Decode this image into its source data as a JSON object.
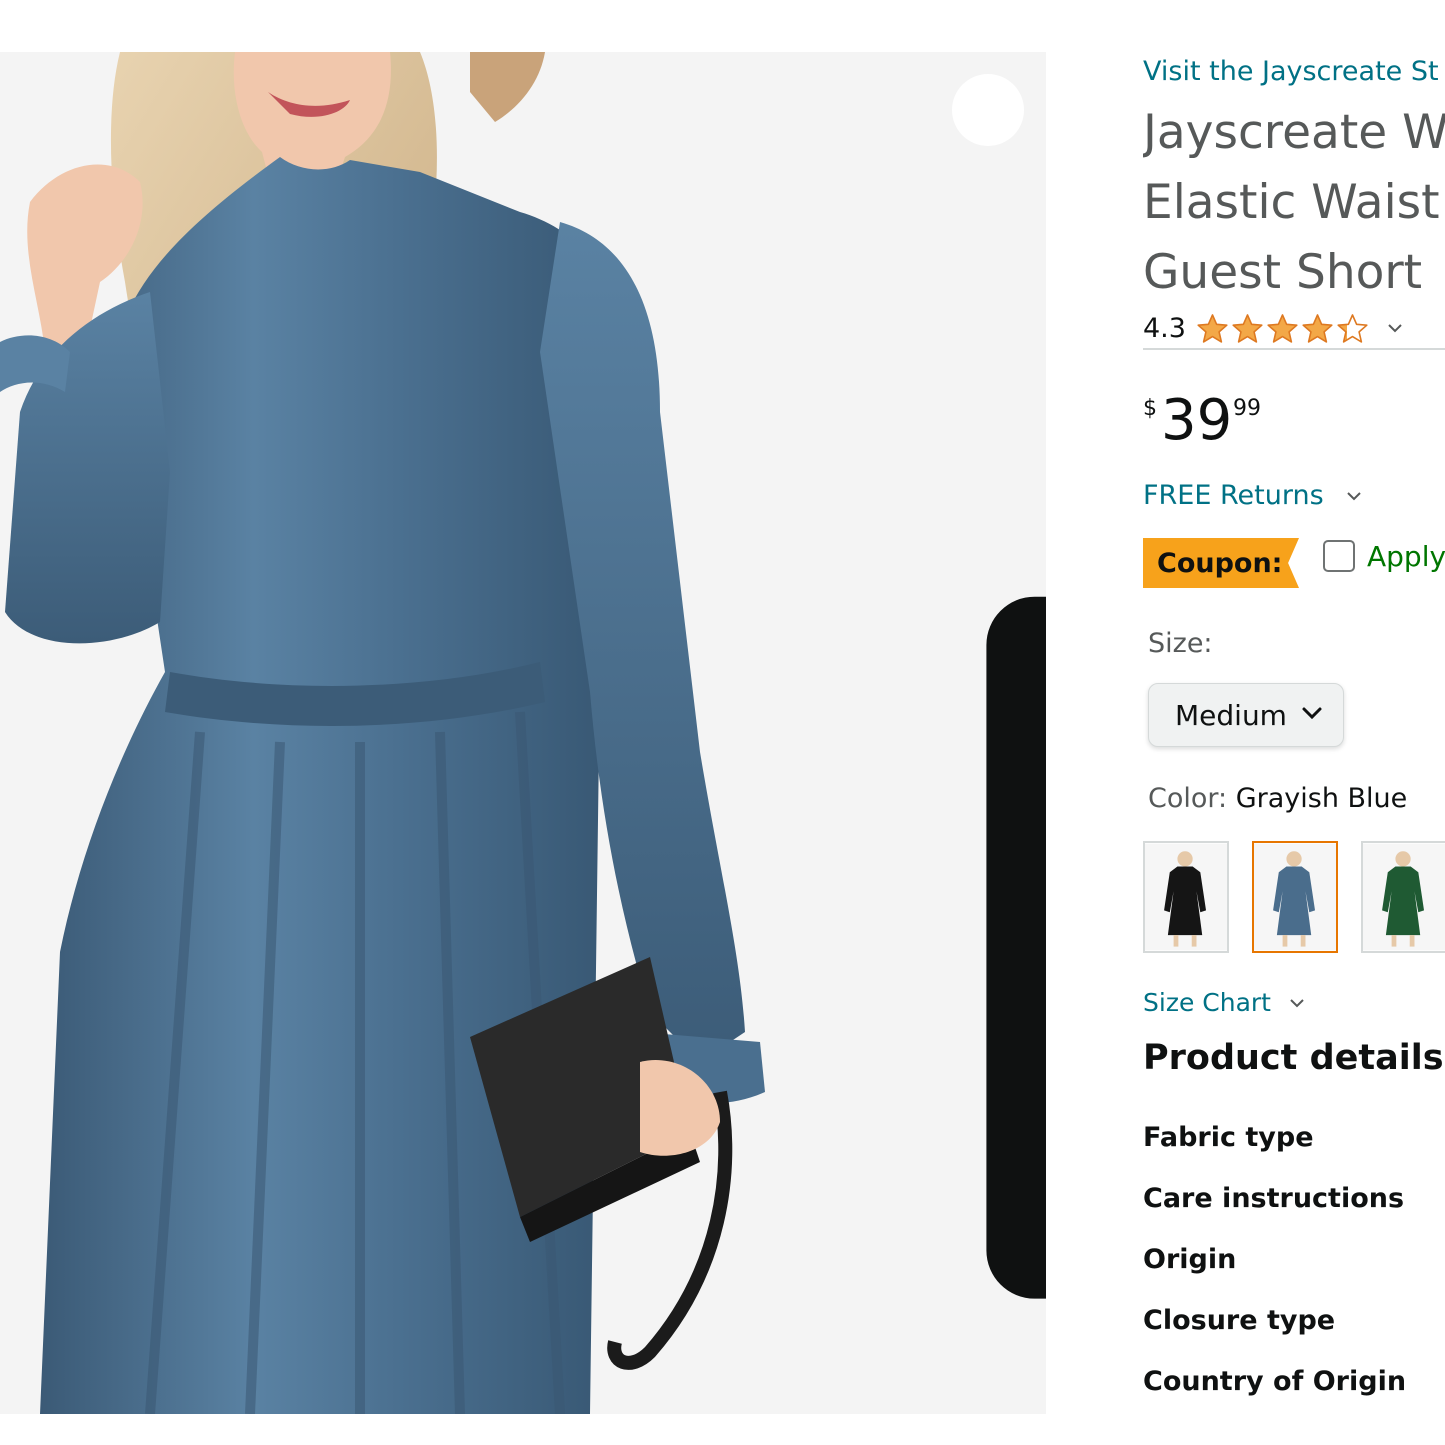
{
  "store": {
    "link_text": "Visit the Jayscreate St"
  },
  "product": {
    "title_lines": [
      "Jayscreate W",
      "Elastic Waist",
      "Guest Short "
    ],
    "rating": "4.3",
    "rating_value": 4.3,
    "rating_max": 5
  },
  "price": {
    "symbol": "$",
    "whole": "39",
    "fraction": "99"
  },
  "returns": {
    "label": "FREE Returns"
  },
  "coupon": {
    "badge": "Coupon:",
    "apply_label": "Apply",
    "checked": false
  },
  "size": {
    "label": "Size:",
    "selected": "Medium"
  },
  "color": {
    "label": "Color:",
    "selected": "Grayish Blue",
    "swatches": [
      {
        "color": "Black",
        "hex": "#151515",
        "selected": false
      },
      {
        "color": "Grayish Blue",
        "hex": "#4a6d8c",
        "selected": true
      },
      {
        "color": "Green",
        "hex": "#1f5a33",
        "selected": false
      }
    ]
  },
  "size_chart": {
    "label": "Size Chart"
  },
  "details": {
    "heading": "Product details",
    "rows": [
      "Fabric type",
      "Care instructions",
      "Origin",
      "Closure type",
      "Country of Origin"
    ]
  },
  "icons": {
    "share": "share-icon",
    "star": "star-icon",
    "chevron": "chevron-down-icon"
  },
  "colors": {
    "link": "#007185",
    "coupon_badge": "#f7a21b",
    "apply_green": "#007600",
    "star": "#f3a847",
    "swatch_selected_border": "#e77600",
    "dress": "#4b6f8e"
  }
}
